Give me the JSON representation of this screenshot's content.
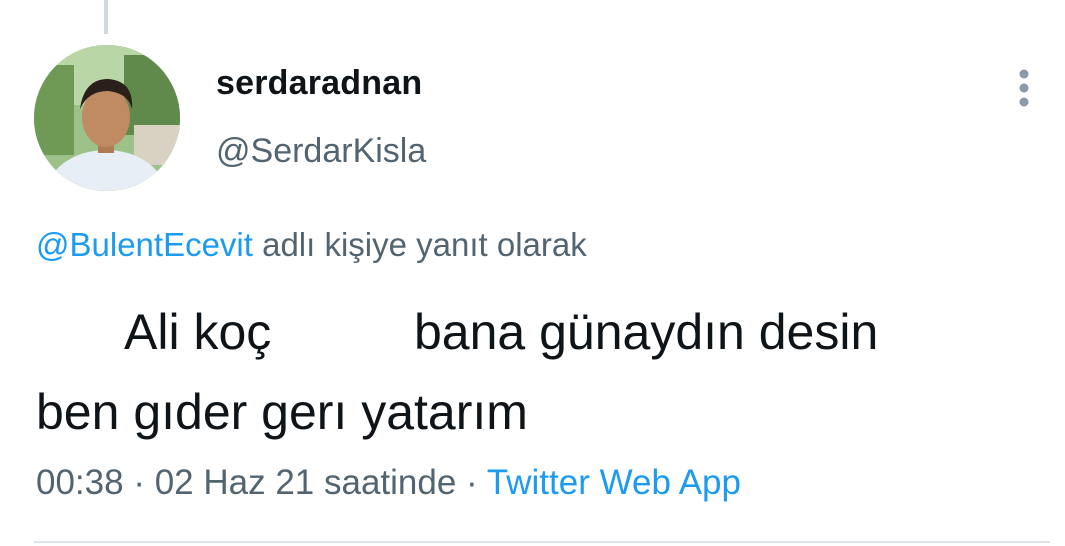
{
  "tweet": {
    "display_name": "serdaradnan",
    "handle": "@SerdarKisla",
    "reply_to": {
      "mention": "@BulentEcevit",
      "suffix": " adlı kişiye yanıt olarak"
    },
    "text": {
      "line1_part1": "Ali koç",
      "line1_part2": "bana günaydın desin",
      "line2": "ben gıder gerı yatarım"
    },
    "time": "00:38",
    "separator": " · ",
    "date": "02 Haz 21 saatinde",
    "source": "Twitter Web App"
  },
  "icons": {
    "avatar": "profile-photo",
    "more": "more-vertical-icon"
  },
  "colors": {
    "text_primary": "#0f1419",
    "text_secondary": "#536471",
    "link": "#1d9bf0",
    "divider": "#dfe4e8"
  }
}
